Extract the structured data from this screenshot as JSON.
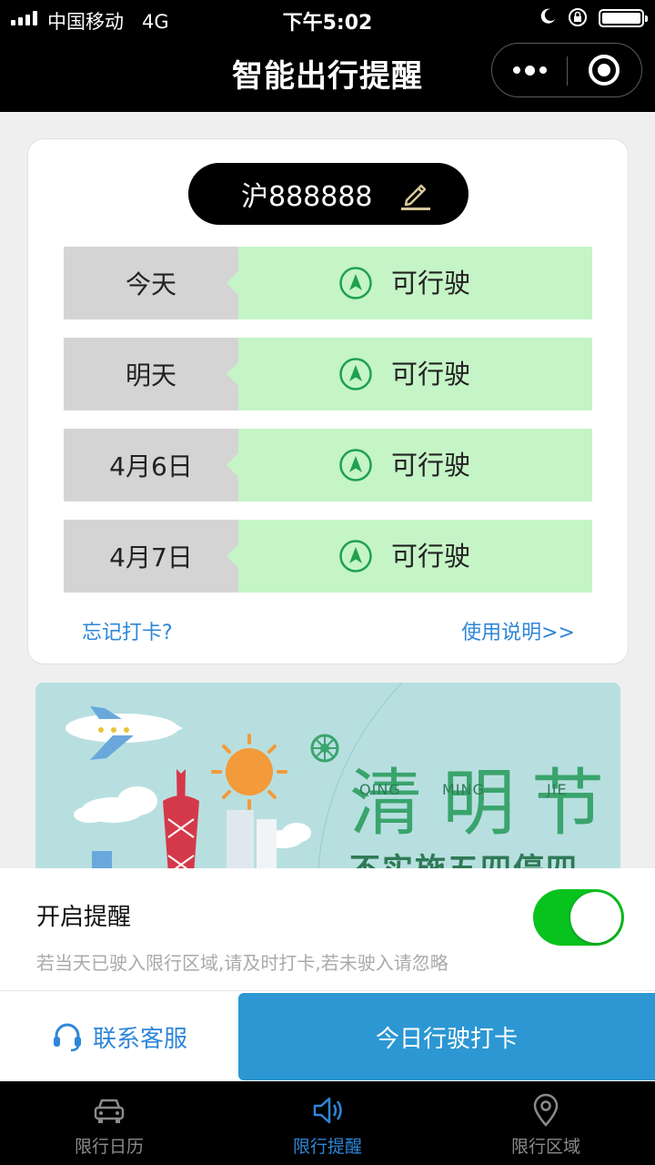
{
  "status_bar": {
    "carrier": "中国移动",
    "network": "4G",
    "time": "下午5:02"
  },
  "nav": {
    "title": "智能出行提醒"
  },
  "plate": {
    "number": "沪888888"
  },
  "schedule": [
    {
      "day": "今天",
      "status": "可行驶"
    },
    {
      "day": "明天",
      "status": "可行驶"
    },
    {
      "day": "4月6日",
      "status": "可行驶"
    },
    {
      "day": "4月7日",
      "status": "可行驶"
    }
  ],
  "links": {
    "forgot": "忘记打卡?",
    "help": "使用说明>>"
  },
  "banner": {
    "chars": [
      "清",
      "明",
      "节"
    ],
    "pinyin": [
      "QING",
      "MING",
      "JIE"
    ],
    "subtitle": "不实施五四停四"
  },
  "reminder": {
    "title": "开启提醒",
    "description": "若当天已驶入限行区域,请及时打卡,若未驶入请忽略",
    "enabled": true
  },
  "actions": {
    "support": "联系客服",
    "checkin": "今日行驶打卡"
  },
  "tabs": [
    {
      "label": "限行日历",
      "icon": "car-icon",
      "active": false
    },
    {
      "label": "限行提醒",
      "icon": "speaker-icon",
      "active": true
    },
    {
      "label": "限行区域",
      "icon": "location-pin-icon",
      "active": false
    }
  ],
  "colors": {
    "accent": "#2e86d8",
    "allowed_bg": "#c5f4c6",
    "allowed_icon": "#1fa14f",
    "toggle_on": "#08c21e",
    "checkin_button": "#2c97d3"
  }
}
